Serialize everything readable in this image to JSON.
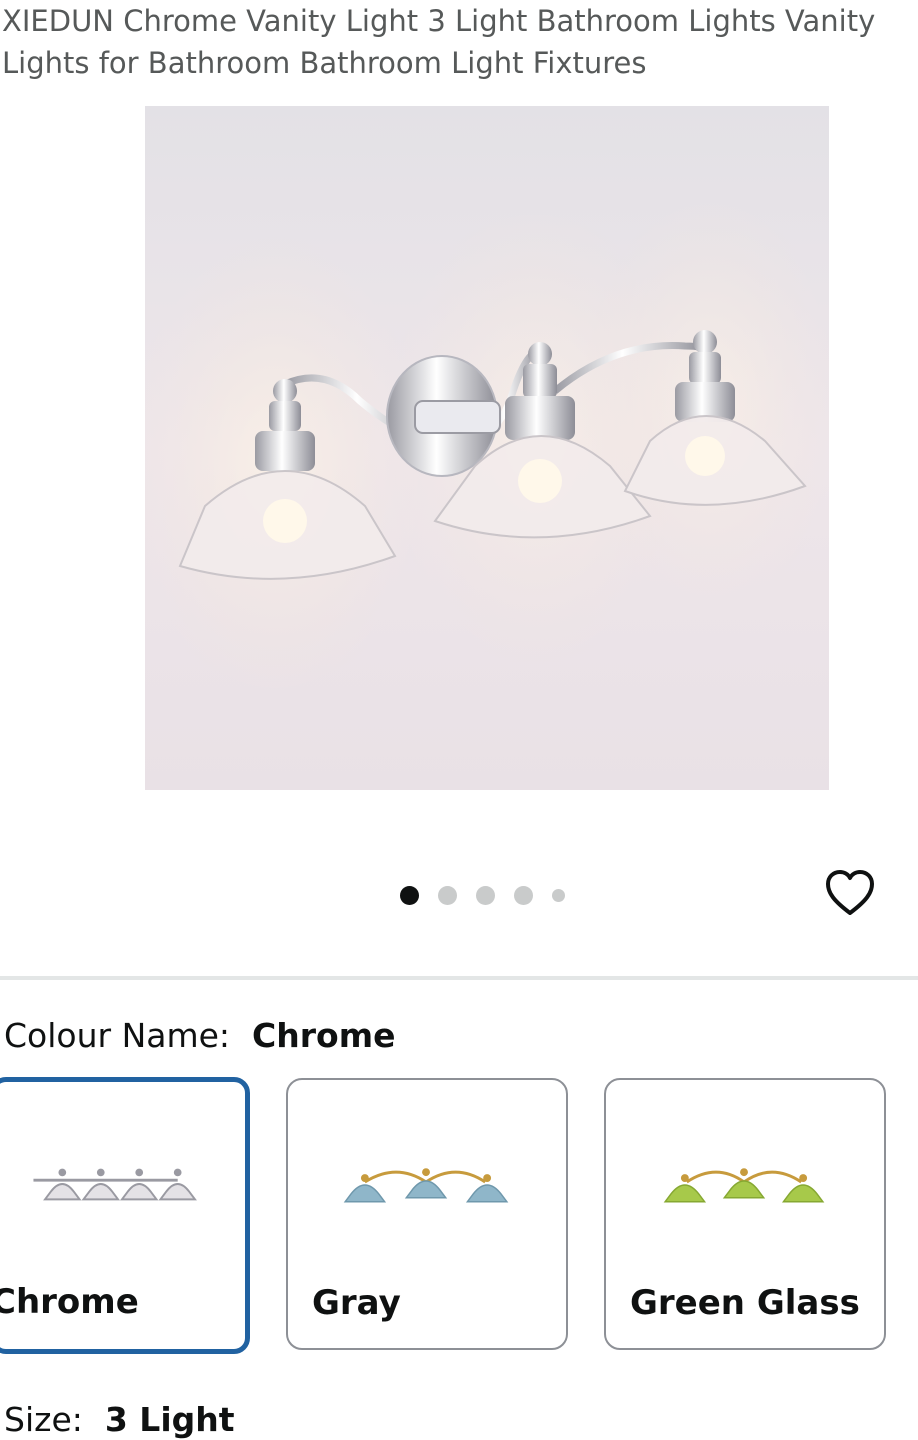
{
  "product": {
    "title": "XIEDUN Chrome Vanity Light 3 Light Bathroom Lights Vanity Lights for Bathroom Bathroom Light Fixtures",
    "image_count": 5,
    "active_image": 1
  },
  "icons": {
    "favorite": "heart-outline-icon"
  },
  "variants": {
    "colour": {
      "label": "Colour Name:",
      "selected": "Chrome",
      "options": [
        {
          "name": "Chrome",
          "selected": true
        },
        {
          "name": "Gray",
          "selected": false
        },
        {
          "name": "Green Glass",
          "selected": false
        }
      ]
    },
    "size": {
      "label": "Size:",
      "selected": "3 Light"
    }
  },
  "colors": {
    "selected_border": "#2162a1",
    "dot_active": "#0f1111",
    "dot_inactive": "#c9cbcb"
  }
}
